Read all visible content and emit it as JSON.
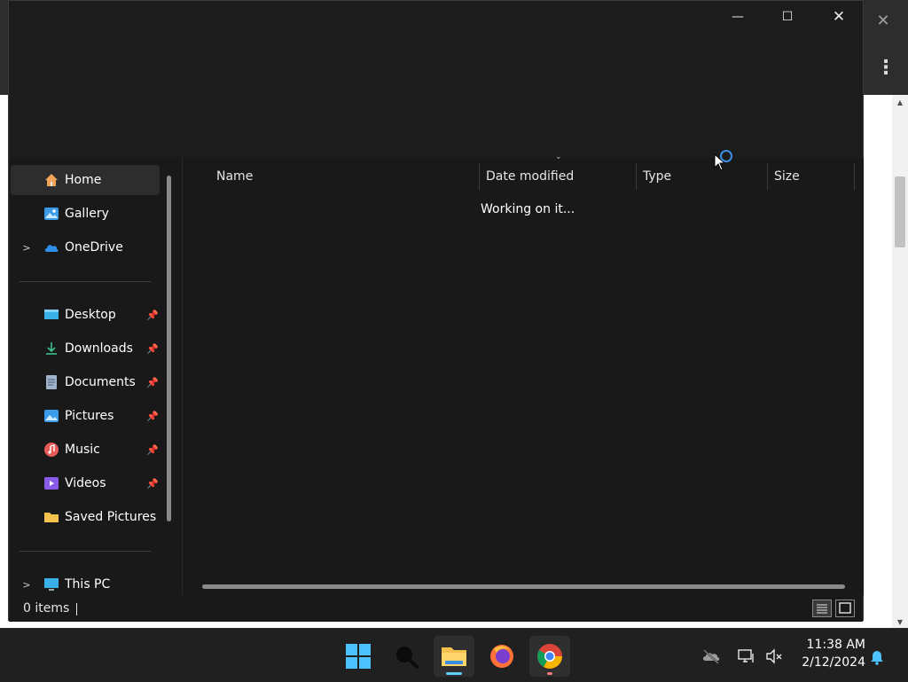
{
  "explorer": {
    "nav": {
      "items": [
        {
          "label": "Home",
          "icon": "home-icon",
          "selected": true
        },
        {
          "label": "Gallery",
          "icon": "gallery-icon"
        },
        {
          "label": "OneDrive",
          "icon": "onedrive-cloud-icon",
          "expandable": true
        },
        {
          "label": "Desktop",
          "icon": "desktop-icon",
          "pinned": true
        },
        {
          "label": "Downloads",
          "icon": "download-arrow-icon",
          "pinned": true
        },
        {
          "label": "Documents",
          "icon": "document-icon",
          "pinned": true
        },
        {
          "label": "Pictures",
          "icon": "pictures-icon",
          "pinned": true
        },
        {
          "label": "Music",
          "icon": "music-icon",
          "pinned": true
        },
        {
          "label": "Videos",
          "icon": "video-icon",
          "pinned": true
        },
        {
          "label": "Saved Pictures",
          "icon": "folder-icon"
        },
        {
          "label": "This PC",
          "icon": "computer-icon",
          "expandable": true
        }
      ],
      "expand_glyph": ">",
      "pin_glyph": "📌"
    },
    "columns": {
      "name": "Name",
      "date_modified": "Date modified",
      "type": "Type",
      "size": "Size"
    },
    "working_text": "Working on it...",
    "status": {
      "item_count": "0 items"
    },
    "window_buttons": {
      "minimize": "—",
      "maximize": "☐",
      "close": "✕"
    }
  },
  "background_browser": {
    "close_glyph": "✕",
    "menu_glyph": "⋮"
  },
  "taskbar": {
    "apps": [
      "windows-start-icon",
      "search-icon",
      "file-explorer-icon",
      "firefox-icon",
      "chrome-icon"
    ],
    "time": "11:38 AM",
    "date": "2/12/2024"
  },
  "colors": {
    "accent": "#3b8fe0",
    "taskbar_indicator": "#60cdff",
    "chrome_indicator": "#f07a7a"
  }
}
